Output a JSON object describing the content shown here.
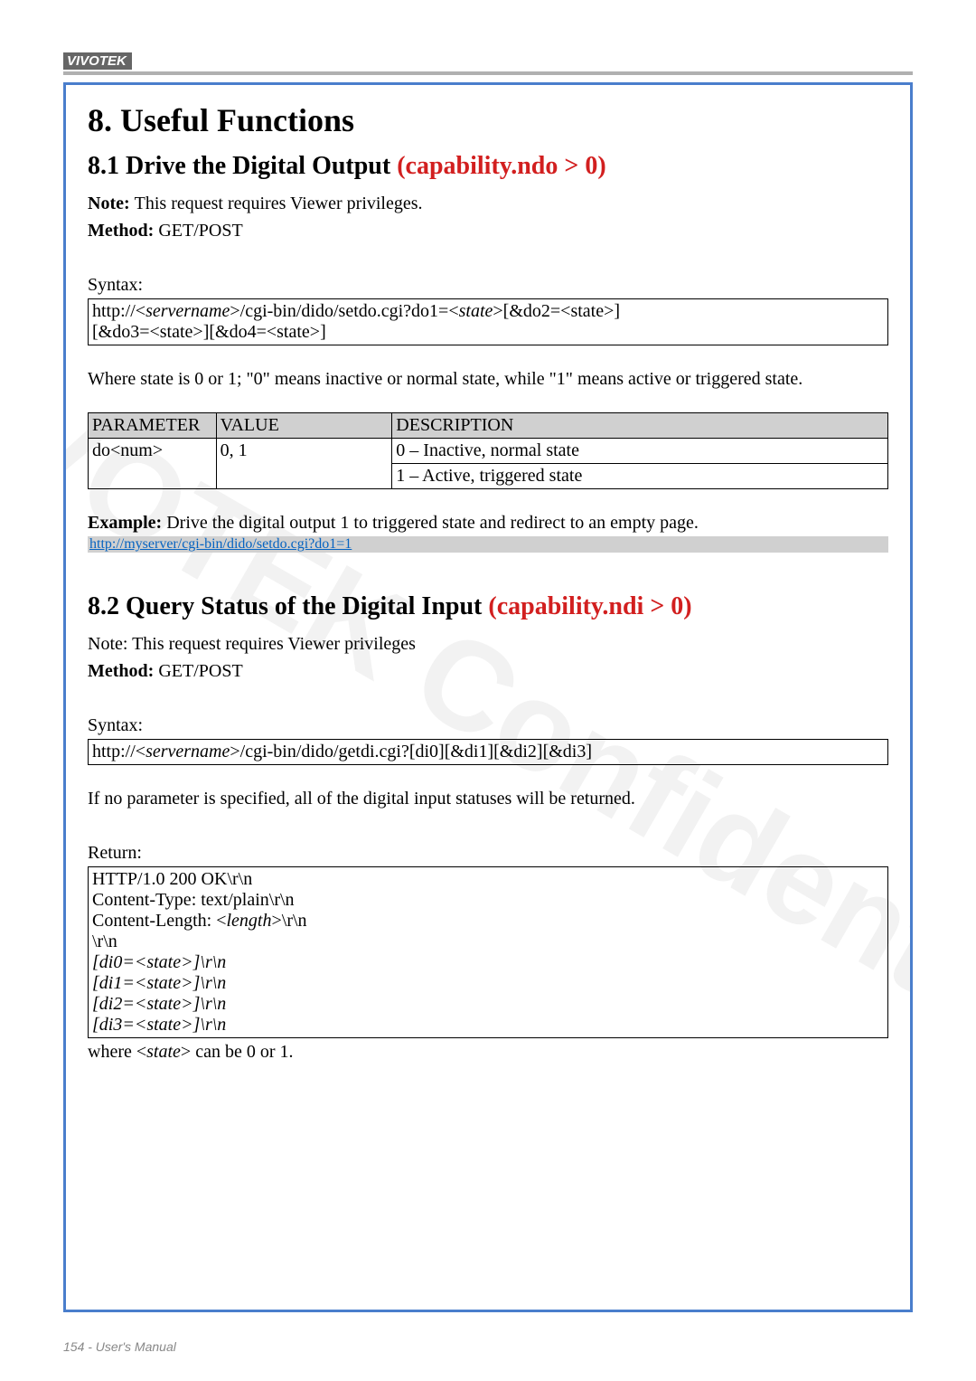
{
  "brand": "VIVOTEK",
  "watermark": "VIVOTEK Confidential",
  "h1": "8. Useful Functions",
  "sec1": {
    "title_main": "8.1 Drive the Digital Output ",
    "title_cap": "(capability.ndo > 0)",
    "note_label": "Note: ",
    "note_text": "This request requires Viewer privileges.",
    "method_label": "Method: ",
    "method_value": "GET/POST",
    "syntax_label": "Syntax:",
    "syntax_pre": "http://<",
    "syntax_srv": "servername",
    "syntax_mid1": ">/cgi-bin/dido/setdo.cgi?do1=<",
    "syntax_state": "state",
    "syntax_mid2": ">[&do2=<state>]",
    "syntax_line2": "[&do3=<state>][&do4=<state>]",
    "state_explain": "Where state is 0 or 1; \"0\" means inactive or normal state, while \"1\" means active or triggered state.",
    "th_param": "PARAMETER",
    "th_value": "VALUE",
    "th_desc": "DESCRIPTION",
    "row_param": "do<num>",
    "row_value": "0, 1",
    "row_desc1": "0 – Inactive, normal state",
    "row_desc2": "1 – Active, triggered state",
    "example_label": "Example: ",
    "example_text": "Drive the digital output 1 to triggered state and redirect to an empty page.",
    "example_link": "http://myserver/cgi-bin/dido/setdo.cgi?do1=1"
  },
  "sec2": {
    "title_main": "8.2 Query Status of the Digital Input ",
    "title_cap": "(capability.ndi > 0)",
    "note_text": "Note: This request requires Viewer privileges",
    "method_label": "Method: ",
    "method_value": "GET/POST",
    "syntax_label": "Syntax:",
    "syntax_pre": "http://<",
    "syntax_srv": "servername",
    "syntax_post": ">/cgi-bin/dido/getdi.cgi?[di0][&di1][&di2][&di3]",
    "noparam": "If no parameter is specified, all of the digital input statuses will be returned.",
    "return_label": "Return:",
    "ret": {
      "l1": "HTTP/1.0 200 OK\\r\\n",
      "l2": "Content-Type: text/plain\\r\\n",
      "l3a": "Content-Length: <",
      "l3b": "length",
      "l3c": ">\\r\\n",
      "l4": "\\r\\n",
      "l5": "[di0=<state>]\\r\\n",
      "l6": "[di1=<state>]\\r\\n",
      "l7": "[di2=<state>]\\r\\n",
      "l8": "[di3=<state>]\\r\\n"
    },
    "where_a": "where <",
    "where_b": "state",
    "where_c": "> can be 0 or 1."
  },
  "footer": "154 - User's Manual"
}
